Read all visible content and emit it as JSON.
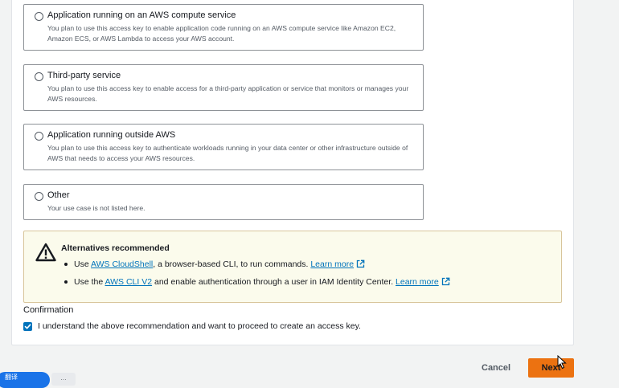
{
  "options": [
    {
      "title": "Application running on an AWS compute service",
      "description": "You plan to use this access key to enable application code running on an AWS compute service like Amazon EC2, Amazon ECS, or AWS Lambda to access your AWS account."
    },
    {
      "title": "Third-party service",
      "description": "You plan to use this access key to enable access for a third-party application or service that monitors or manages your AWS resources."
    },
    {
      "title": "Application running outside AWS",
      "description": "You plan to use this access key to authenticate workloads running in your data center or other infrastructure outside of AWS that needs to access your AWS resources."
    },
    {
      "title": "Other",
      "description": "Your use case is not listed here."
    }
  ],
  "alert": {
    "title": "Alternatives recommended",
    "items": [
      {
        "prefix": "Use ",
        "link": "AWS CloudShell",
        "middle": ", a browser-based CLI, to run commands. ",
        "learn_more": "Learn more"
      },
      {
        "prefix": "Use the ",
        "link": "AWS CLI V2",
        "middle": " and enable authentication through a user in IAM Identity Center. ",
        "learn_more": "Learn more"
      }
    ]
  },
  "confirmation": {
    "label": "Confirmation",
    "checked": true,
    "text": "I understand the above recommendation and want to proceed to create an access key."
  },
  "footer": {
    "cancel_label": "Cancel",
    "next_label": "Next"
  },
  "overlay": {
    "pill_text": "翻译",
    "chip_text": "…"
  },
  "colors": {
    "link": "#0073bb",
    "primary_button": "#ec7211",
    "alert_background": "#fbfbec",
    "alert_border": "#d8c59b"
  }
}
